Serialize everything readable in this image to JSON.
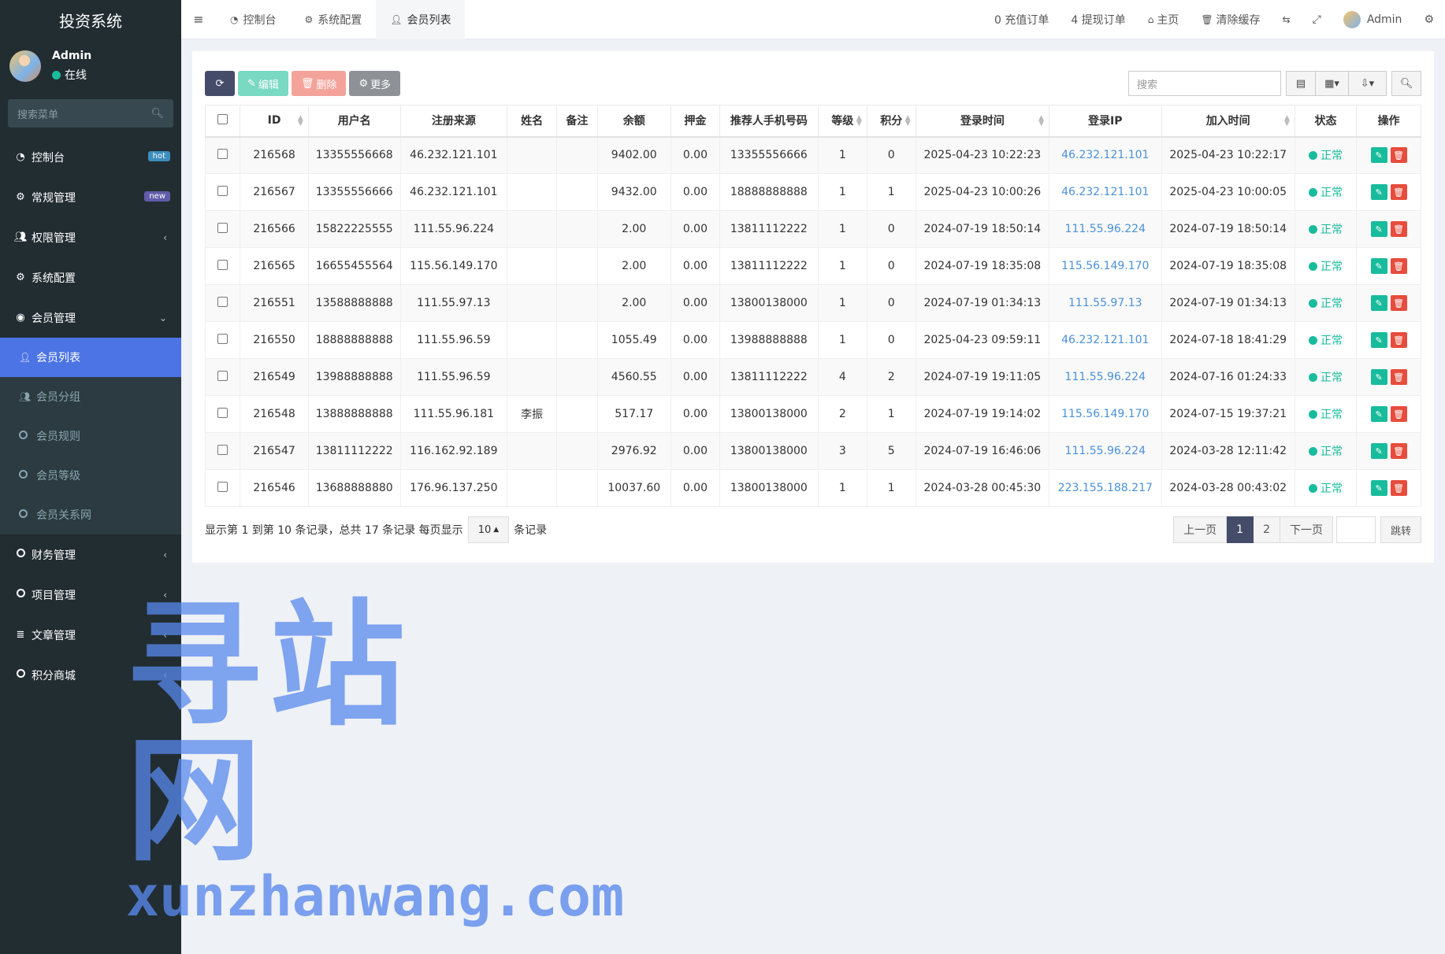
{
  "app": {
    "title": "投资系统"
  },
  "user": {
    "name": "Admin",
    "status": "在线"
  },
  "sidebar": {
    "search_placeholder": "搜索菜单",
    "items": [
      {
        "label": "控制台",
        "icon": "dashboard-icon",
        "badge": "hot"
      },
      {
        "label": "常规管理",
        "icon": "cogs-icon",
        "badge": "new"
      },
      {
        "label": "权限管理",
        "icon": "group-icon"
      },
      {
        "label": "系统配置",
        "icon": "gear-icon"
      },
      {
        "label": "会员管理",
        "icon": "user-circle-icon"
      }
    ],
    "sub_items": [
      {
        "label": "会员列表"
      },
      {
        "label": "会员分组"
      },
      {
        "label": "会员规则"
      },
      {
        "label": "会员等级"
      },
      {
        "label": "会员关系网"
      }
    ],
    "items_after": [
      {
        "label": "财务管理"
      },
      {
        "label": "项目管理"
      },
      {
        "label": "文章管理"
      },
      {
        "label": "积分商城"
      }
    ]
  },
  "header": {
    "tabs": [
      {
        "label": "控制台"
      },
      {
        "label": "系统配置"
      },
      {
        "label": "会员列表"
      }
    ],
    "recharge": "0 充值订单",
    "withdraw": "4 提现订单",
    "home": "主页",
    "clear_cache": "清除缓存",
    "admin": "Admin"
  },
  "toolbar": {
    "edit": "编辑",
    "delete": "删除",
    "more": "更多",
    "search_placeholder": "搜索"
  },
  "table": {
    "headers": [
      "ID",
      "用户名",
      "注册来源",
      "姓名",
      "备注",
      "余额",
      "押金",
      "推荐人手机号码",
      "等级",
      "积分",
      "登录时间",
      "登录IP",
      "加入时间",
      "状态",
      "操作"
    ],
    "rows": [
      [
        "216568",
        "13355556668",
        "46.232.121.101",
        "",
        "",
        "9402.00",
        "0.00",
        "13355556666",
        "1",
        "0",
        "2025-04-23 10:22:23",
        "46.232.121.101",
        "2025-04-23 10:22:17",
        "正常"
      ],
      [
        "216567",
        "13355556666",
        "46.232.121.101",
        "",
        "",
        "9432.00",
        "0.00",
        "18888888888",
        "1",
        "1",
        "2025-04-23 10:00:26",
        "46.232.121.101",
        "2025-04-23 10:00:05",
        "正常"
      ],
      [
        "216566",
        "15822225555",
        "111.55.96.224",
        "",
        "",
        "2.00",
        "0.00",
        "13811112222",
        "1",
        "0",
        "2024-07-19 18:50:14",
        "111.55.96.224",
        "2024-07-19 18:50:14",
        "正常"
      ],
      [
        "216565",
        "16655455564",
        "115.56.149.170",
        "",
        "",
        "2.00",
        "0.00",
        "13811112222",
        "1",
        "0",
        "2024-07-19 18:35:08",
        "115.56.149.170",
        "2024-07-19 18:35:08",
        "正常"
      ],
      [
        "216551",
        "13588888888",
        "111.55.97.13",
        "",
        "",
        "2.00",
        "0.00",
        "13800138000",
        "1",
        "0",
        "2024-07-19 01:34:13",
        "111.55.97.13",
        "2024-07-19 01:34:13",
        "正常"
      ],
      [
        "216550",
        "18888888888",
        "111.55.96.59",
        "",
        "",
        "1055.49",
        "0.00",
        "13988888888",
        "1",
        "0",
        "2025-04-23 09:59:11",
        "46.232.121.101",
        "2024-07-18 18:41:29",
        "正常"
      ],
      [
        "216549",
        "13988888888",
        "111.55.96.59",
        "",
        "",
        "4560.55",
        "0.00",
        "13811112222",
        "4",
        "2",
        "2024-07-19 19:11:05",
        "111.55.96.224",
        "2024-07-16 01:24:33",
        "正常"
      ],
      [
        "216548",
        "13888888888",
        "111.55.96.181",
        "李振",
        "",
        "517.17",
        "0.00",
        "13800138000",
        "2",
        "1",
        "2024-07-19 19:14:02",
        "115.56.149.170",
        "2024-07-15 19:37:21",
        "正常"
      ],
      [
        "216547",
        "13811112222",
        "116.162.92.189",
        "",
        "",
        "2976.92",
        "0.00",
        "13800138000",
        "3",
        "5",
        "2024-07-19 16:46:06",
        "111.55.96.224",
        "2024-03-28 12:11:42",
        "正常"
      ],
      [
        "216546",
        "13688888880",
        "176.96.137.250",
        "",
        "",
        "10037.60",
        "0.00",
        "13800138000",
        "1",
        "1",
        "2024-03-28 00:45:30",
        "223.155.188.217",
        "2024-03-28 00:43:02",
        "正常"
      ]
    ]
  },
  "footer": {
    "info": "显示第 1 到第 10 条记录，总共 17 条记录 每页显示",
    "per_page": "10",
    "suffix": "条记录",
    "prev": "上一页",
    "page1": "1",
    "page2": "2",
    "next": "下一页",
    "jump": "跳转"
  },
  "watermark": {
    "cn": "寻站网",
    "en": "xunzhanwang.com"
  }
}
